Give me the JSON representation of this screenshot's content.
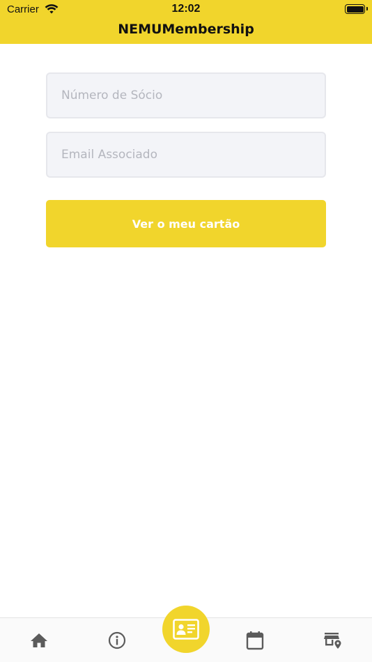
{
  "status_bar": {
    "carrier": "Carrier",
    "time": "12:02"
  },
  "nav": {
    "title": "NEMUMembership"
  },
  "form": {
    "member_number": {
      "value": "",
      "placeholder": "Número de Sócio"
    },
    "email": {
      "value": "",
      "placeholder": "Email Associado"
    },
    "submit_label": "Ver o meu cartão"
  },
  "tabbar": {
    "tabs": [
      {
        "icon": "home-icon"
      },
      {
        "icon": "info-icon"
      },
      {
        "icon": "id-card-icon",
        "selected": true
      },
      {
        "icon": "calendar-icon"
      },
      {
        "icon": "store-location-icon"
      }
    ]
  },
  "colors": {
    "brand_yellow": "#F1D52C",
    "tab_icon": "#5B5B5B"
  }
}
